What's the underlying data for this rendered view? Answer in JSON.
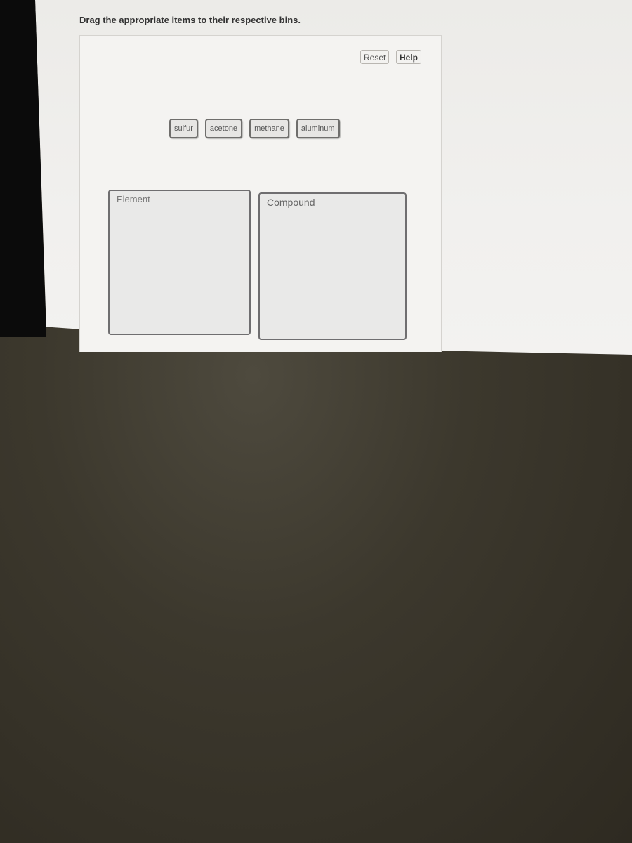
{
  "instruction": "Drag the appropriate items to their respective bins.",
  "toolbar": {
    "reset_label": "Reset",
    "help_label": "Help"
  },
  "items": [
    {
      "label": "sulfur"
    },
    {
      "label": "acetone"
    },
    {
      "label": "methane"
    },
    {
      "label": "aluminum"
    }
  ],
  "bins": [
    {
      "label": "Element"
    },
    {
      "label": "Compound"
    }
  ]
}
